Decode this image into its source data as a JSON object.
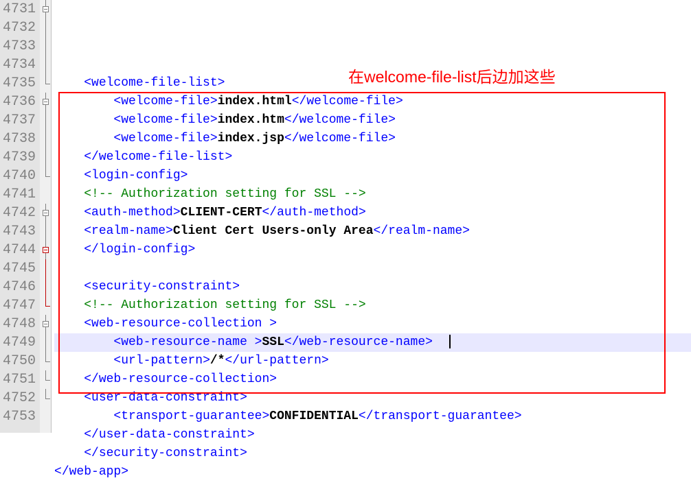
{
  "annotation_text": "在welcome-file-list后边加这些",
  "highlighted_line": 4745,
  "lines": [
    {
      "n": 4731,
      "fold": "box-minus",
      "segs": [
        {
          "c": "angle",
          "t": "    <"
        },
        {
          "c": "tag",
          "t": "welcome-file-list"
        },
        {
          "c": "angle",
          "t": ">"
        }
      ]
    },
    {
      "n": 4732,
      "fold": "vert",
      "segs": [
        {
          "c": "angle",
          "t": "        <"
        },
        {
          "c": "tag",
          "t": "welcome-file"
        },
        {
          "c": "angle",
          "t": ">"
        },
        {
          "c": "txt",
          "t": "index.html"
        },
        {
          "c": "angle",
          "t": "</"
        },
        {
          "c": "tag",
          "t": "welcome-file"
        },
        {
          "c": "angle",
          "t": ">"
        }
      ]
    },
    {
      "n": 4733,
      "fold": "vert",
      "segs": [
        {
          "c": "angle",
          "t": "        <"
        },
        {
          "c": "tag",
          "t": "welcome-file"
        },
        {
          "c": "angle",
          "t": ">"
        },
        {
          "c": "txt",
          "t": "index.htm"
        },
        {
          "c": "angle",
          "t": "</"
        },
        {
          "c": "tag",
          "t": "welcome-file"
        },
        {
          "c": "angle",
          "t": ">"
        }
      ]
    },
    {
      "n": 4734,
      "fold": "vert",
      "segs": [
        {
          "c": "angle",
          "t": "        <"
        },
        {
          "c": "tag",
          "t": "welcome-file"
        },
        {
          "c": "angle",
          "t": ">"
        },
        {
          "c": "txt",
          "t": "index.jsp"
        },
        {
          "c": "angle",
          "t": "</"
        },
        {
          "c": "tag",
          "t": "welcome-file"
        },
        {
          "c": "angle",
          "t": ">"
        }
      ]
    },
    {
      "n": 4735,
      "fold": "corner",
      "segs": [
        {
          "c": "angle",
          "t": "    </"
        },
        {
          "c": "tag",
          "t": "welcome-file-list"
        },
        {
          "c": "angle",
          "t": ">"
        }
      ]
    },
    {
      "n": 4736,
      "fold": "box-minus",
      "segs": [
        {
          "c": "angle",
          "t": "    <"
        },
        {
          "c": "tag",
          "t": "login-config"
        },
        {
          "c": "angle",
          "t": ">"
        }
      ]
    },
    {
      "n": 4737,
      "fold": "vert",
      "segs": [
        {
          "c": "cmt",
          "t": "    <!-- Authorization setting for SSL -->"
        }
      ]
    },
    {
      "n": 4738,
      "fold": "vert",
      "segs": [
        {
          "c": "angle",
          "t": "    <"
        },
        {
          "c": "tag",
          "t": "auth-method"
        },
        {
          "c": "angle",
          "t": ">"
        },
        {
          "c": "txt",
          "t": "CLIENT-CERT"
        },
        {
          "c": "angle",
          "t": "</"
        },
        {
          "c": "tag",
          "t": "auth-method"
        },
        {
          "c": "angle",
          "t": ">"
        }
      ]
    },
    {
      "n": 4739,
      "fold": "vert",
      "segs": [
        {
          "c": "angle",
          "t": "    <"
        },
        {
          "c": "tag",
          "t": "realm-name"
        },
        {
          "c": "angle",
          "t": ">"
        },
        {
          "c": "txt",
          "t": "Client Cert Users-only Area"
        },
        {
          "c": "angle",
          "t": "</"
        },
        {
          "c": "tag",
          "t": "realm-name"
        },
        {
          "c": "angle",
          "t": ">"
        }
      ]
    },
    {
      "n": 4740,
      "fold": "corner",
      "segs": [
        {
          "c": "angle",
          "t": "    </"
        },
        {
          "c": "tag",
          "t": "login-config"
        },
        {
          "c": "angle",
          "t": ">"
        }
      ]
    },
    {
      "n": 4741,
      "fold": "none",
      "segs": [
        {
          "c": "",
          "t": ""
        }
      ]
    },
    {
      "n": 4742,
      "fold": "box-minus",
      "segs": [
        {
          "c": "angle",
          "t": "    <"
        },
        {
          "c": "tag",
          "t": "security-constraint"
        },
        {
          "c": "angle",
          "t": ">"
        }
      ]
    },
    {
      "n": 4743,
      "fold": "vert",
      "segs": [
        {
          "c": "cmt",
          "t": "    <!-- Authorization setting for SSL -->"
        }
      ]
    },
    {
      "n": 4744,
      "fold": "box-red",
      "segs": [
        {
          "c": "angle",
          "t": "    <"
        },
        {
          "c": "tag",
          "t": "web-resource-collection "
        },
        {
          "c": "angle",
          "t": ">"
        }
      ]
    },
    {
      "n": 4745,
      "fold": "vert-red",
      "hl": true,
      "segs": [
        {
          "c": "angle",
          "t": "        <"
        },
        {
          "c": "tag",
          "t": "web-resource-name "
        },
        {
          "c": "angle",
          "t": ">"
        },
        {
          "c": "txt",
          "t": "SSL"
        },
        {
          "c": "angle",
          "t": "</"
        },
        {
          "c": "tag",
          "t": "web-resource-name"
        },
        {
          "c": "angle",
          "t": ">"
        }
      ],
      "caret": true
    },
    {
      "n": 4746,
      "fold": "vert-red",
      "segs": [
        {
          "c": "angle",
          "t": "        <"
        },
        {
          "c": "tag",
          "t": "url-pattern"
        },
        {
          "c": "angle",
          "t": ">"
        },
        {
          "c": "txt",
          "t": "/*"
        },
        {
          "c": "angle",
          "t": "</"
        },
        {
          "c": "tag",
          "t": "url-pattern"
        },
        {
          "c": "angle",
          "t": ">"
        }
      ]
    },
    {
      "n": 4747,
      "fold": "corner-red",
      "segs": [
        {
          "c": "angle",
          "t": "    </"
        },
        {
          "c": "tag",
          "t": "web-resource-collection"
        },
        {
          "c": "angle",
          "t": ">"
        }
      ]
    },
    {
      "n": 4748,
      "fold": "box-minus",
      "segs": [
        {
          "c": "angle",
          "t": "    <"
        },
        {
          "c": "tag",
          "t": "user-data-constraint"
        },
        {
          "c": "angle",
          "t": ">"
        }
      ]
    },
    {
      "n": 4749,
      "fold": "vert",
      "segs": [
        {
          "c": "angle",
          "t": "        <"
        },
        {
          "c": "tag",
          "t": "transport-guarantee"
        },
        {
          "c": "angle",
          "t": ">"
        },
        {
          "c": "txt",
          "t": "CONFIDENTIAL"
        },
        {
          "c": "angle",
          "t": "</"
        },
        {
          "c": "tag",
          "t": "transport-guarantee"
        },
        {
          "c": "angle",
          "t": ">"
        }
      ]
    },
    {
      "n": 4750,
      "fold": "corner",
      "segs": [
        {
          "c": "angle",
          "t": "    </"
        },
        {
          "c": "tag",
          "t": "user-data-constraint"
        },
        {
          "c": "angle",
          "t": ">"
        }
      ]
    },
    {
      "n": 4751,
      "fold": "corner",
      "segs": [
        {
          "c": "angle",
          "t": "    </"
        },
        {
          "c": "tag",
          "t": "security-constraint"
        },
        {
          "c": "angle",
          "t": ">"
        }
      ]
    },
    {
      "n": 4752,
      "fold": "corner",
      "segs": [
        {
          "c": "angle",
          "t": "</"
        },
        {
          "c": "tag",
          "t": "web-app"
        },
        {
          "c": "angle",
          "t": ">"
        }
      ]
    },
    {
      "n": 4753,
      "fold": "none",
      "segs": [
        {
          "c": "",
          "t": ""
        }
      ]
    }
  ]
}
